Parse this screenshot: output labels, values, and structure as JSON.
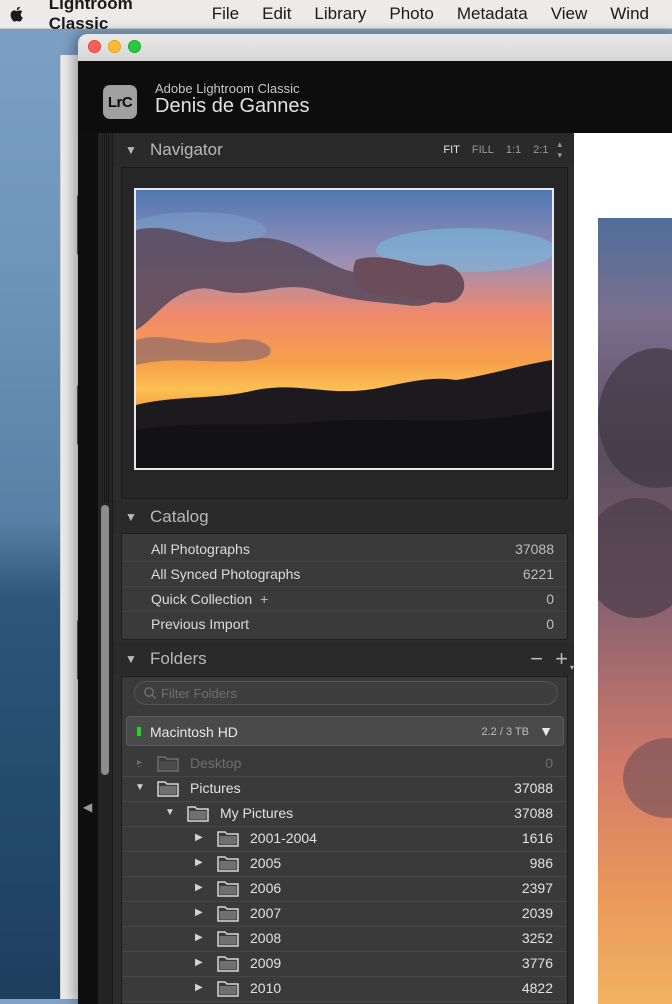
{
  "menubar": {
    "app_name": "Lightroom Classic",
    "items": [
      "File",
      "Edit",
      "Library",
      "Photo",
      "Metadata",
      "View",
      "Wind"
    ]
  },
  "identity": {
    "logo_text": "LrC",
    "product": "Adobe Lightroom Classic",
    "user": "Denis de Gannes"
  },
  "navigator": {
    "title": "Navigator",
    "zoom_options": [
      "FIT",
      "FILL",
      "1:1",
      "2:1"
    ],
    "active_zoom": "FIT"
  },
  "catalog": {
    "title": "Catalog",
    "rows": [
      {
        "label": "All Photographs",
        "count": "37088"
      },
      {
        "label": "All Synced Photographs",
        "count": "6221"
      },
      {
        "label": "Quick Collection",
        "plus": "+",
        "count": "0"
      },
      {
        "label": "Previous Import",
        "count": "0"
      }
    ]
  },
  "folders": {
    "title": "Folders",
    "minus": "−",
    "plus": "+",
    "search_placeholder": "Filter Folders",
    "volume": {
      "name": "Macintosh HD",
      "size": "2.2 / 3 TB"
    },
    "rows": [
      {
        "name": "Desktop",
        "count": "0",
        "dim": true,
        "expanded": false
      },
      {
        "name": "Pictures",
        "count": "37088",
        "expanded": true
      },
      {
        "name": "My Pictures",
        "count": "37088",
        "expanded": true
      },
      {
        "name": "2001-2004",
        "count": "1616",
        "expanded": false
      },
      {
        "name": "2005",
        "count": "986",
        "expanded": false
      },
      {
        "name": "2006",
        "count": "2397",
        "expanded": false
      },
      {
        "name": "2007",
        "count": "2039",
        "expanded": false
      },
      {
        "name": "2008",
        "count": "3252",
        "expanded": false
      },
      {
        "name": "2009",
        "count": "3776",
        "expanded": false
      },
      {
        "name": "2010",
        "count": "4822",
        "expanded": false
      }
    ]
  },
  "colors": {
    "panel_bg": "#2d2d2d",
    "row_bg": "#3a3a3a",
    "text": "#dcdcdc",
    "led_green": "#3ec13e"
  }
}
